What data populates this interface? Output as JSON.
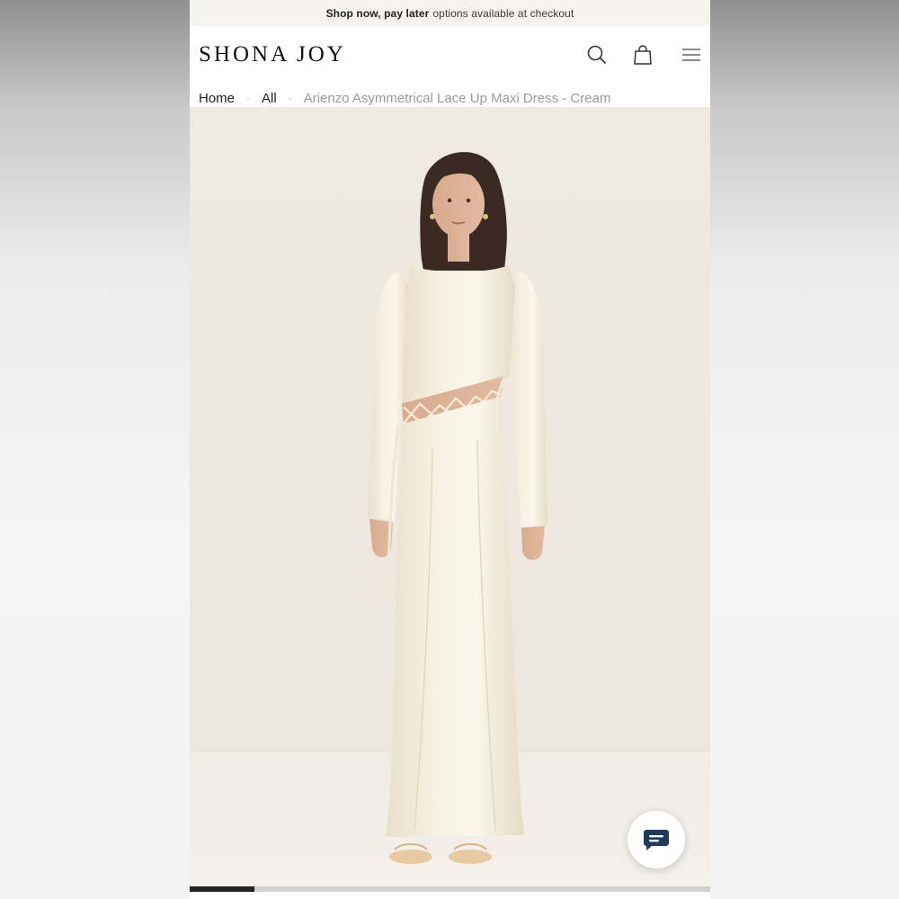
{
  "promo": {
    "strong": "Shop now, pay later",
    "rest": "options available at checkout"
  },
  "header": {
    "logo": "SHONA JOY",
    "icons": [
      "search-icon",
      "bag-icon",
      "menu-icon"
    ]
  },
  "breadcrumb": {
    "home": "Home",
    "all": "All",
    "current": "Arienzo Asymmetrical Lace Up Maxi Dress - Cream",
    "separator": "·"
  },
  "gallery": {
    "image_alt": "Model wearing cream satin long-sleeve maxi dress with lace up cut-out",
    "progress": 0.125
  },
  "chat": {
    "icon": "chat-icon"
  },
  "colors": {
    "promo_bg": "#f6f4ee",
    "photo_bg": "#efe9e2",
    "dress": "#f3ecdc",
    "accent": "#1f3b5c"
  }
}
